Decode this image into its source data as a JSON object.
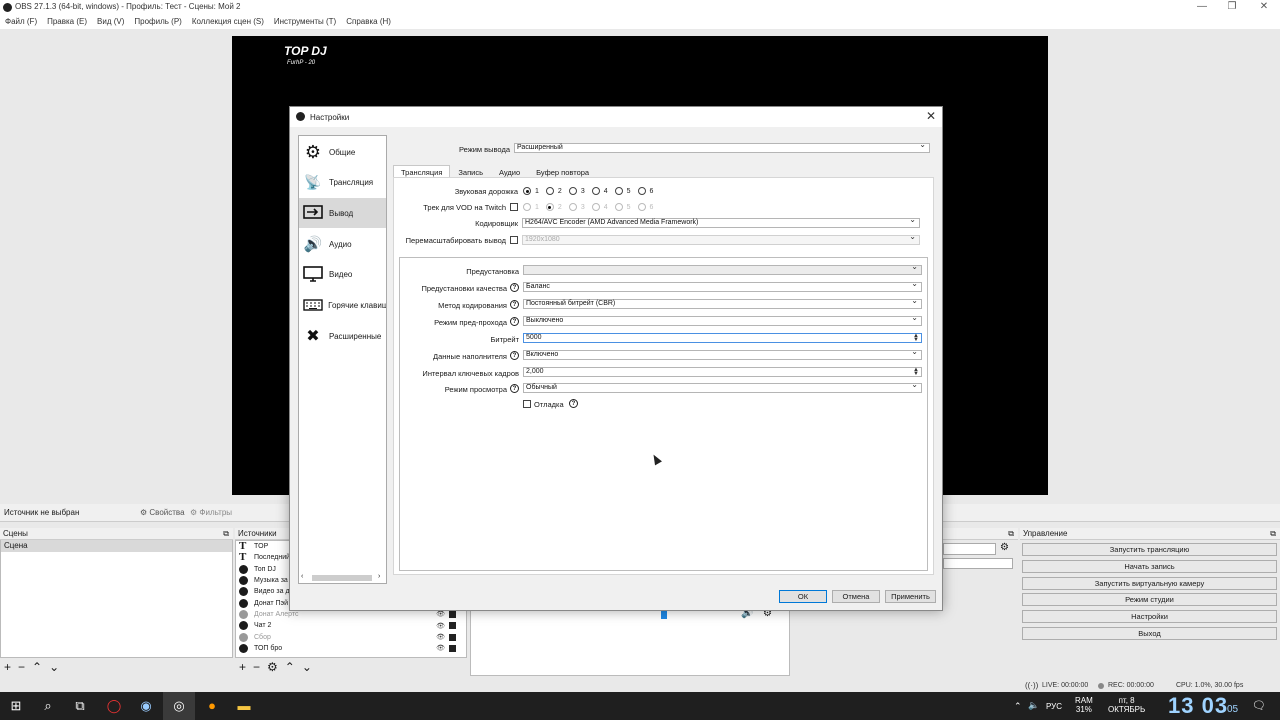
{
  "window": {
    "title": "OBS 27.1.3 (64-bit, windows) - Профиль: Тест - Сцены: Мой 2",
    "controls": [
      "—",
      "❐",
      "✕"
    ]
  },
  "menu": [
    "Файл (F)",
    "Правка (E)",
    "Вид (V)",
    "Профиль (P)",
    "Коллекция сцен (S)",
    "Инструменты (T)",
    "Справка (H)"
  ],
  "preview": {
    "logo_main": "TOP DJ",
    "logo_sub": "FurhP - 20"
  },
  "source_bar": {
    "status": "Источник не выбран",
    "properties": "Свойства",
    "filters": "Фильтры"
  },
  "docks": {
    "scenes": {
      "title": "Сцены",
      "items": [
        "Сцена"
      ]
    },
    "sources": {
      "title": "Источники",
      "items": [
        {
          "name": "TOP",
          "icon": "text",
          "dim": false
        },
        {
          "name": "Последний",
          "icon": "text",
          "dim": false
        },
        {
          "name": "Топ DJ",
          "icon": "globe",
          "dim": false
        },
        {
          "name": "Музыка за",
          "icon": "globe",
          "dim": false
        },
        {
          "name": "Видео за д",
          "icon": "globe",
          "dim": false
        },
        {
          "name": "Донат Пэй",
          "icon": "globe",
          "dim": false
        },
        {
          "name": "Донат Алертс",
          "icon": "globe",
          "dim": true
        },
        {
          "name": "Чат 2",
          "icon": "globe",
          "dim": false
        },
        {
          "name": "Сбор",
          "icon": "globe",
          "dim": true
        },
        {
          "name": "ТОП бро",
          "icon": "globe",
          "dim": false
        }
      ]
    },
    "controls": {
      "title": "Управление",
      "buttons": [
        "Запустить трансляцию",
        "Начать запись",
        "Запустить виртуальную камеру",
        "Режим студии",
        "Настройки",
        "Выход"
      ]
    }
  },
  "status_bar": {
    "live": "LIVE: 00:00:00",
    "rec": "REC: 00:00:00",
    "cpu": "CPU: 1.0%, 30.00 fps"
  },
  "taskbar": {
    "lang": "РУС",
    "ram_label": "RAM",
    "ram_value": "31%",
    "date_line1": "пт, 8",
    "date_line2": "ОКТЯБРЬ",
    "time": "13 03",
    "seconds": "05"
  },
  "settings": {
    "title": "Настройки",
    "nav": [
      {
        "label": "Общие",
        "icon": "gear-icon"
      },
      {
        "label": "Трансляция",
        "icon": "antenna-icon"
      },
      {
        "label": "Вывод",
        "icon": "output-icon"
      },
      {
        "label": "Аудио",
        "icon": "speaker-icon"
      },
      {
        "label": "Видео",
        "icon": "monitor-icon"
      },
      {
        "label": "Горячие клавиш",
        "icon": "keyboard-icon"
      },
      {
        "label": "Расширенные",
        "icon": "tools-icon"
      }
    ],
    "active_nav": "Вывод",
    "output_mode_label": "Режим вывода",
    "output_mode_value": "Расширенный",
    "tabs": [
      "Трансляция",
      "Запись",
      "Аудио",
      "Буфер повтора"
    ],
    "active_tab": "Трансляция",
    "audio_track_label": "Звуковая дорожка",
    "audio_tracks": [
      "1",
      "2",
      "3",
      "4",
      "5",
      "6"
    ],
    "audio_track_selected": "1",
    "vod_label": "Трек для VOD на Twitch",
    "vod_tracks": [
      "1",
      "2",
      "3",
      "4",
      "5",
      "6"
    ],
    "vod_selected": "2",
    "encoder_label": "Кодировщик",
    "encoder_value": "H264/AVC Encoder (AMD Advanced Media Framework)",
    "rescale_label": "Перемасштабировать вывод",
    "rescale_value": "1920x1080",
    "fields": {
      "preset": {
        "label": "Предустановка",
        "value": ""
      },
      "quality": {
        "label": "Предустановки качества",
        "value": "Баланс"
      },
      "method": {
        "label": "Метод кодирования",
        "value": "Постоянный битрейт (CBR)"
      },
      "prepass": {
        "label": "Режим пред-прохода",
        "value": "Выключено"
      },
      "bitrate": {
        "label": "Битрейт",
        "value": "5000"
      },
      "filler": {
        "label": "Данные наполнителя",
        "value": "Включено"
      },
      "keyint": {
        "label": "Интервал ключевых кадров",
        "value": "2,000"
      },
      "view": {
        "label": "Режим просмотра",
        "value": "Обычный"
      }
    },
    "debug_label": "Отладка",
    "buttons": {
      "ok": "ОК",
      "cancel": "Отмена",
      "apply": "Применить"
    }
  }
}
